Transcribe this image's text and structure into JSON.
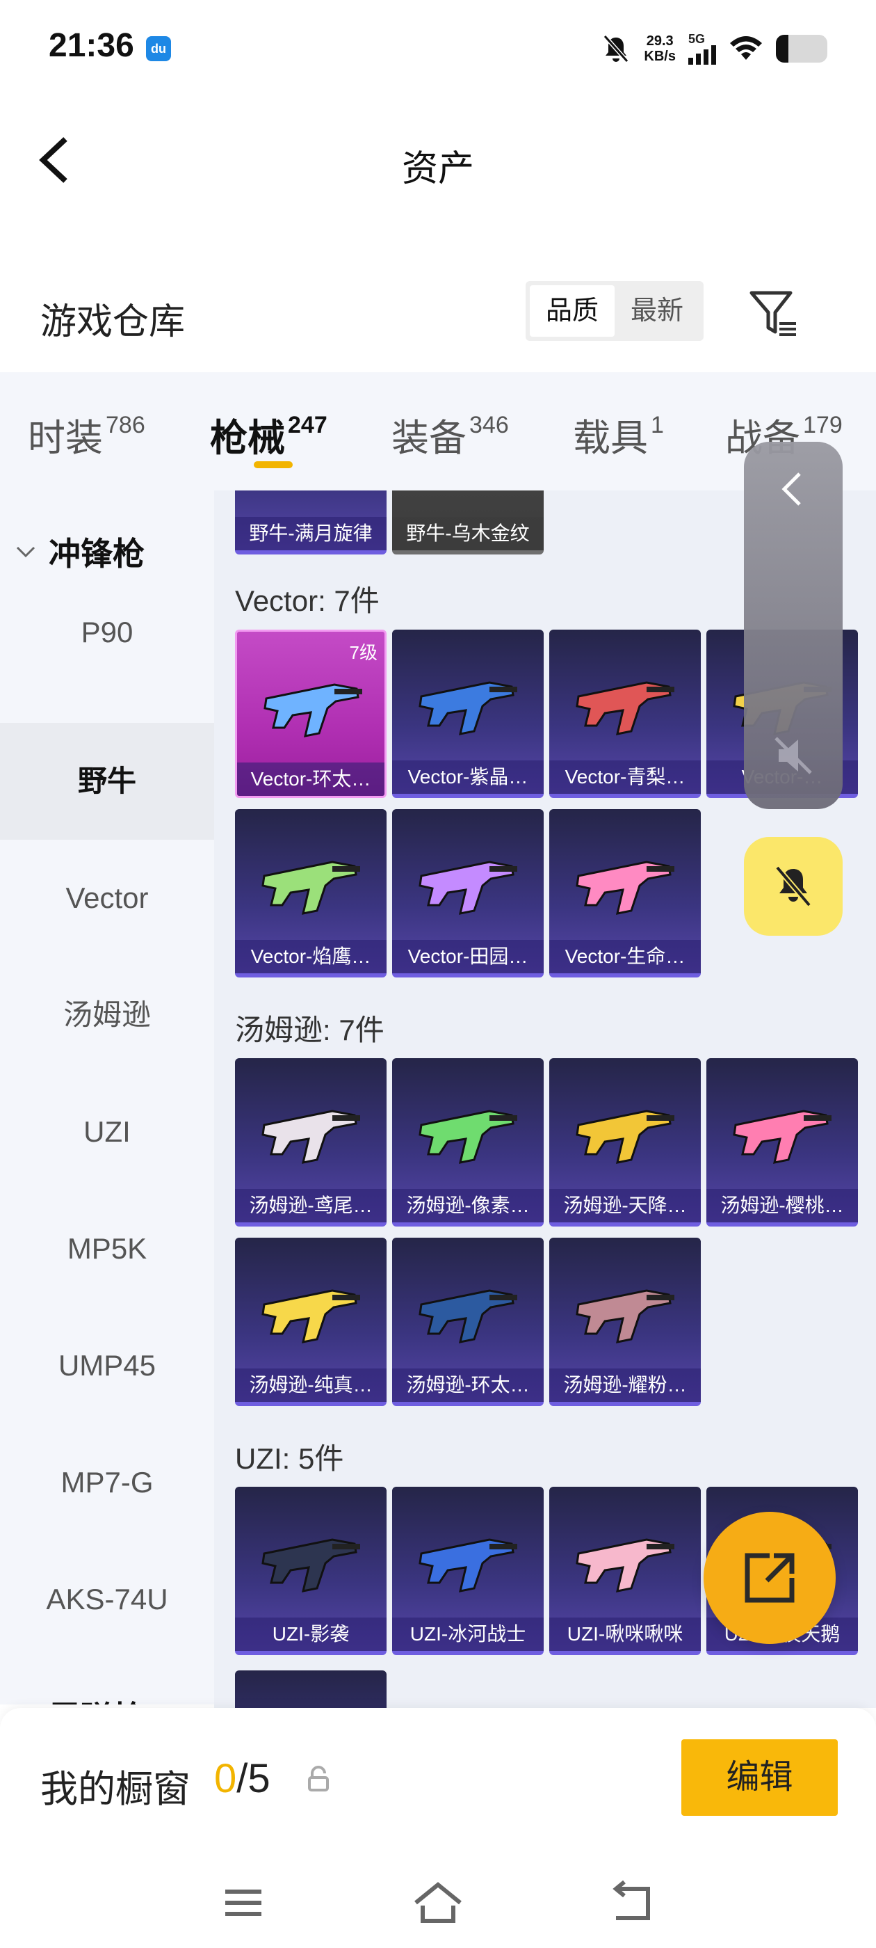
{
  "status_bar": {
    "time": "21:36",
    "app_icon": "du",
    "net_speed_value": "29.3",
    "net_speed_unit": "KB/s",
    "network_type": "5G"
  },
  "header": {
    "title": "资产"
  },
  "warehouse": {
    "title": "游戏仓库",
    "sort_options": [
      "品质",
      "最新"
    ],
    "active_sort": "品质"
  },
  "tabs": [
    {
      "label": "时装",
      "count": "786"
    },
    {
      "label": "枪械",
      "count": "247",
      "active": true
    },
    {
      "label": "装备",
      "count": "346"
    },
    {
      "label": "载具",
      "count": "1"
    },
    {
      "label": "战备",
      "count": "179"
    }
  ],
  "sidebar": {
    "group": "冲锋枪",
    "items": [
      "P90",
      "野牛",
      "Vector",
      "汤姆逊",
      "UZI",
      "MP5K",
      "UMP45",
      "MP7-G",
      "AKS-74U"
    ],
    "active": "野牛",
    "next_group": "霰弹枪"
  },
  "content": {
    "top_partial_cards": [
      "野牛-满月旋律",
      "野牛-乌木金纹"
    ],
    "groups": [
      {
        "label": "Vector: 7件",
        "items": [
          {
            "name": "Vector-环太…",
            "level": "7级",
            "rarity": "legend"
          },
          {
            "name": "Vector-紫晶…"
          },
          {
            "name": "Vector-青梨…"
          },
          {
            "name": "Vector-…"
          },
          {
            "name": "Vector-焰鹰…"
          },
          {
            "name": "Vector-田园…"
          },
          {
            "name": "Vector-生命…"
          }
        ]
      },
      {
        "label": "汤姆逊: 7件",
        "items": [
          {
            "name": "汤姆逊-鸢尾…"
          },
          {
            "name": "汤姆逊-像素…"
          },
          {
            "name": "汤姆逊-天降…"
          },
          {
            "name": "汤姆逊-樱桃…"
          },
          {
            "name": "汤姆逊-纯真…"
          },
          {
            "name": "汤姆逊-环太…"
          },
          {
            "name": "汤姆逊-耀粉…"
          }
        ]
      },
      {
        "label": "UZI: 5件",
        "items": [
          {
            "name": "UZI-影袭"
          },
          {
            "name": "UZI-冰河战士"
          },
          {
            "name": "UZI-啾咪啾咪"
          },
          {
            "name": "UZI-她夜天鹅"
          }
        ]
      }
    ]
  },
  "showcase": {
    "title": "我的橱窗",
    "current": "0",
    "total": "/5",
    "edit_label": "编辑"
  },
  "colors": {
    "accent": "#f2b400",
    "card_epic": "#3b3581",
    "card_legend": "#b02fb2"
  }
}
